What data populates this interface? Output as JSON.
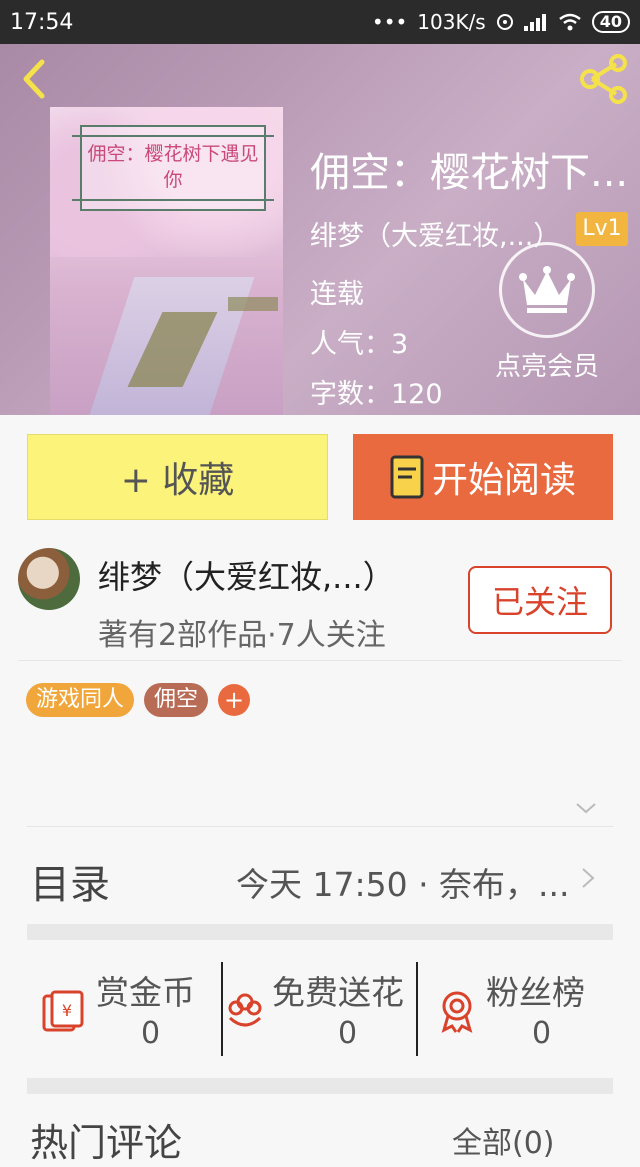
{
  "status_bar": {
    "time": "17:54",
    "dots": "•••",
    "network_speed": "103K/s",
    "battery": "40"
  },
  "header": {
    "back_icon": "back-arrow-icon",
    "share_icon": "share-icon"
  },
  "book": {
    "cover_title": "佣空：樱花树下遇见你",
    "title": "佣空：樱花树下...",
    "author": "绯梦（大爱红妆,...）",
    "level": "Lv1",
    "status": "连载",
    "popularity": "人气：3",
    "word_count": "字数：120"
  },
  "vip": {
    "label": "点亮会员",
    "icon": "crown-icon"
  },
  "actions": {
    "favorite_label": "+ 收藏",
    "read_label": "开始阅读"
  },
  "author_info": {
    "name": "绯梦（大爱红妆,...）",
    "stats": "著有2部作品·7人关注",
    "follow_label": "已关注"
  },
  "tags": [
    "游戏同人",
    "佣空"
  ],
  "tag_add": "+",
  "toc": {
    "title": "目录",
    "latest": "今天 17:50 · 奈布，..."
  },
  "rewards": [
    {
      "label": "赏金币",
      "value": "0",
      "icon": "red-envelope-icon"
    },
    {
      "label": "免费送花",
      "value": "0",
      "icon": "flower-icon"
    },
    {
      "label": "粉丝榜",
      "value": "0",
      "icon": "medal-icon"
    }
  ],
  "comments": {
    "title": "热门评论",
    "all_label": "全部(0)"
  },
  "colors": {
    "accent": "#ea6a3f",
    "favorite_bg": "#fbf37a",
    "follow": "#d9432b",
    "level_badge": "#f2b640"
  }
}
